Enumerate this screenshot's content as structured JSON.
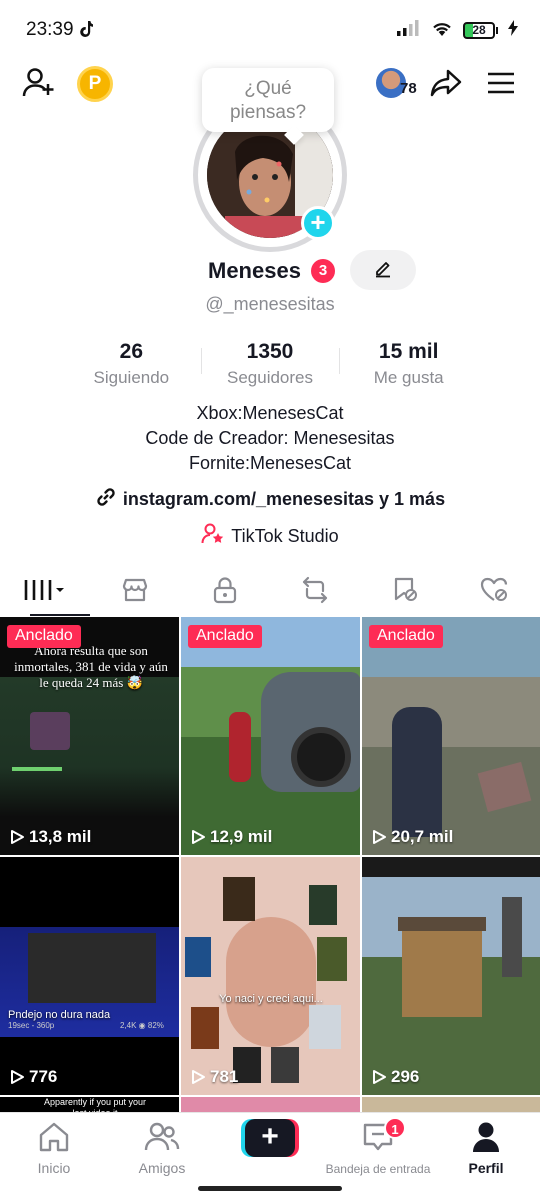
{
  "status_bar": {
    "time": "23:39",
    "battery": "28"
  },
  "header": {
    "bubble_text_line1": "¿Qué",
    "bubble_text_line2": "piensas?",
    "friend_count": "78"
  },
  "profile": {
    "name": "Meneses",
    "name_badge": "3",
    "handle": "@_menesesitas",
    "stats": [
      {
        "value": "26",
        "label": "Siguiendo"
      },
      {
        "value": "1350",
        "label": "Seguidores"
      },
      {
        "value": "15 mil",
        "label": "Me gusta"
      }
    ],
    "bio": [
      "Xbox:MenesesCat",
      "Code de Creador: Menesesitas",
      "Fornite:MenesesCat"
    ],
    "link": "instagram.com/_menesesitas y 1 más",
    "studio": "TikTok Studio"
  },
  "tabs": [
    "videos-grid",
    "shop",
    "private",
    "reposts",
    "saved",
    "liked"
  ],
  "videos": [
    {
      "pinned": "Anclado",
      "views": "13,8 mil",
      "overlay": "Ahora resulta que son inmortales, 381 de vida y aún le queda 24 más 🤯"
    },
    {
      "pinned": "Anclado",
      "views": "12,9 mil"
    },
    {
      "pinned": "Anclado",
      "views": "20,7 mil"
    },
    {
      "views": "776",
      "overlay": "Pndejo no dura nada",
      "sub1": "19sec - 360p",
      "sub2": "2,4K ◉ 82%"
    },
    {
      "views": "781",
      "overlay": "Yo naci y creci aqui..."
    },
    {
      "views": "296"
    },
    {
      "overlay": "Apparently if you put your last video it"
    }
  ],
  "nav": {
    "home": "Inicio",
    "friends": "Amigos",
    "inbox": "Bandeja de entrada",
    "inbox_badge": "1",
    "profile": "Perfil"
  },
  "colors": {
    "accent": "#fe2c55",
    "cyan": "#20d5ec",
    "text": "#161823",
    "muted": "#8a8b91"
  }
}
